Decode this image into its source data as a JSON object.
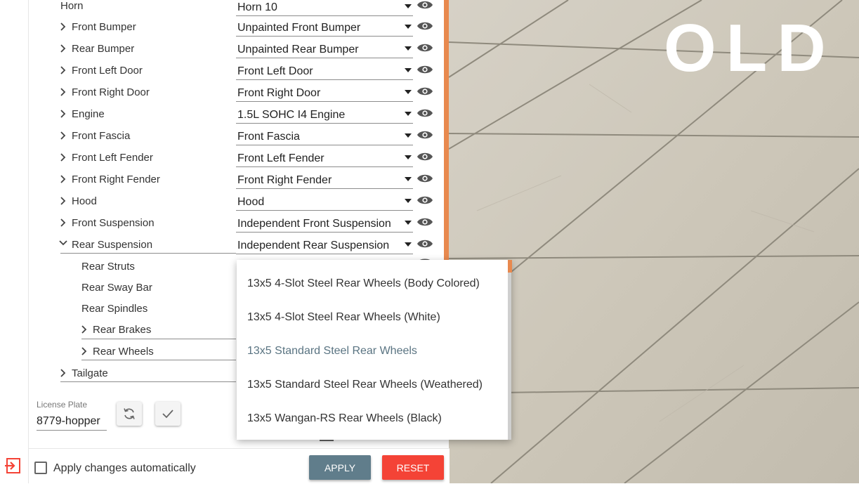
{
  "parts": [
    {
      "label": "Horn",
      "value": "Horn 10",
      "expandable": false
    },
    {
      "label": "Front Bumper",
      "value": "Unpainted Front Bumper",
      "expandable": true
    },
    {
      "label": "Rear Bumper",
      "value": "Unpainted Rear Bumper",
      "expandable": true
    },
    {
      "label": "Front Left Door",
      "value": "Front Left Door",
      "expandable": true
    },
    {
      "label": "Front Right Door",
      "value": "Front Right Door",
      "expandable": true
    },
    {
      "label": "Engine",
      "value": "1.5L SOHC I4 Engine",
      "expandable": true
    },
    {
      "label": "Front Fascia",
      "value": "Front Fascia",
      "expandable": true
    },
    {
      "label": "Front Left Fender",
      "value": "Front Left Fender",
      "expandable": true
    },
    {
      "label": "Front Right Fender",
      "value": "Front Right Fender",
      "expandable": true
    },
    {
      "label": "Hood",
      "value": "Hood",
      "expandable": true
    },
    {
      "label": "Front Suspension",
      "value": "Independent Front Suspension",
      "expandable": true
    },
    {
      "label": "Rear Suspension",
      "value": "Independent Rear Suspension",
      "expandable": true,
      "expanded": true
    }
  ],
  "sub_parts": [
    {
      "label": "Rear Struts"
    },
    {
      "label": "Rear Sway Bar"
    },
    {
      "label": "Rear Spindles"
    },
    {
      "label": "Rear Brakes",
      "expandable": true
    },
    {
      "label": "Rear Wheels",
      "expandable": true
    }
  ],
  "tailgate": {
    "label": "Tailgate"
  },
  "dropdown": {
    "options": [
      "13x5 4-Slot Steel Rear Wheels (Body Colored)",
      "13x5 4-Slot Steel Rear Wheels (White)",
      "13x5 Standard Steel Rear Wheels",
      "13x5 Standard Steel Rear Wheels (Weathered)",
      "13x5 Wangan-RS Rear Wheels (Black)"
    ],
    "selected_index": 2
  },
  "license": {
    "label": "License Plate",
    "value": "8779-hopper"
  },
  "bottom": {
    "auto_label": "Apply changes automatically",
    "apply_label": "APPLY",
    "reset_label": "RESET"
  },
  "scene": {
    "watermark": "OLD"
  },
  "colors": {
    "accent_orange": "#e8894e",
    "apply": "#607d8b",
    "reset": "#f44336",
    "selected_option": "#5a7482"
  },
  "icons": {
    "exit": "exit-icon",
    "visibility": "eye-icon",
    "refresh": "refresh-icon",
    "confirm": "check-icon",
    "expand": "chevron-right-icon",
    "collapse": "chevron-down-icon"
  }
}
